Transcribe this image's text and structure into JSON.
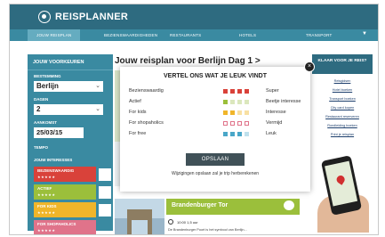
{
  "app": {
    "brand": "REISPLANNER"
  },
  "nav": {
    "items": [
      {
        "label": "JOUW REISPLAN"
      },
      {
        "label": "BEZIENSWAARDIGHEDEN"
      },
      {
        "label": "RESTAURANTS"
      },
      {
        "label": "HOTELS"
      },
      {
        "label": "TRANSPORT"
      }
    ]
  },
  "sidebar": {
    "title": "JOUW VOORKEUREN",
    "bestemming_label": "BESTEMMING",
    "bestemming_value": "Berlijn",
    "dagen_label": "DAGEN",
    "dagen_value": "2",
    "aankomst_label": "AANKOMST",
    "aankomst_value": "25/03/15",
    "tempo_label": "TEMPO",
    "interesses_label": "JOUW INTERESSES",
    "categories": [
      {
        "label": "BEZIENSWAARDIG",
        "stars": "★★★★★",
        "color": "#d9423a"
      },
      {
        "label": "ACTIEF",
        "stars": "★★★★★",
        "color": "#9bbf3b"
      },
      {
        "label": "FOR KIDS",
        "stars": "★★★★★",
        "color": "#f0b52a"
      },
      {
        "label": "FOR SHOPAHOLICS",
        "stars": "★★★★★",
        "color": "#e0738a"
      }
    ]
  },
  "center": {
    "title": "Jouw reisplan voor Berlijn    Dag 1 >",
    "card_title": "Brandenburger Tor",
    "card_time": "10:00    1,5 uur",
    "card_desc": "De Brandenburger Poort is het symbool van Berlijn..."
  },
  "rside": {
    "title": "KLAAR VOOR JE REIS?",
    "links": [
      "Reisgidsen",
      "Hotel boeken",
      "Transport boeken",
      "City card kopen",
      "Restaurant reserveren",
      "Rondleiding boeken",
      "Print je reisplan"
    ]
  },
  "modal": {
    "title": "VERTEL ONS WAT JE LEUK VINDT",
    "prefs": [
      {
        "label": "Bezienswaardig",
        "value": "Super",
        "level": 4,
        "color": "#d9423a",
        "faint": "#d9423a"
      },
      {
        "label": "Actief",
        "value": "Beetje interesse",
        "level": 1,
        "color": "#9bbf3b",
        "faint": "#dbe7bd"
      },
      {
        "label": "For kids",
        "value": "Interesse",
        "level": 2,
        "color": "#f0b52a",
        "faint": "#f8e0a3"
      },
      {
        "label": "For shopaholics",
        "value": "Vermijd",
        "level": 0,
        "color": "#e0738a",
        "faint": "#f4c7d0"
      },
      {
        "label": "For free",
        "value": "Leuk",
        "level": 3,
        "color": "#4aa7c8",
        "faint": "#bfe0ec"
      }
    ],
    "save_label": "OPSLAAN",
    "footnote": "Wijzigingen opslaan zal je trip herberekenen"
  }
}
